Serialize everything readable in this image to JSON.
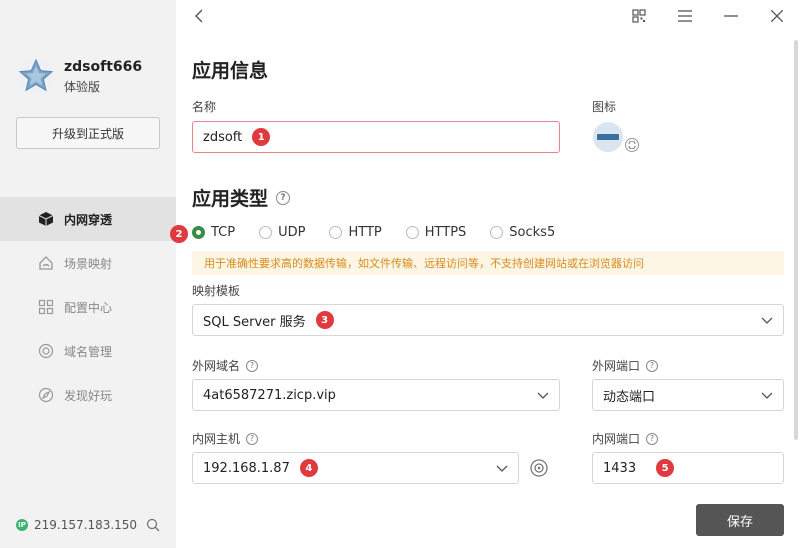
{
  "sidebar": {
    "user_name": "zdsoft666",
    "plan": "体验版",
    "upgrade_label": "升级到正式版",
    "items": [
      {
        "label": "内网穿透",
        "icon": "cube-icon",
        "active": true
      },
      {
        "label": "场景映射",
        "icon": "home-icon",
        "active": false
      },
      {
        "label": "配置中心",
        "icon": "grid-icon",
        "active": false
      },
      {
        "label": "域名管理",
        "icon": "globe-icon",
        "active": false
      },
      {
        "label": "发现好玩",
        "icon": "compass-icon",
        "active": false
      }
    ],
    "ip": "219.157.183.150",
    "ip_badge": "IP"
  },
  "app_info": {
    "title": "应用信息",
    "name_label": "名称",
    "name_value": "zdsoft",
    "name_badge": "1",
    "icon_label": "图标"
  },
  "app_type": {
    "title": "应用类型",
    "help": "?",
    "badge": "2",
    "options": [
      "TCP",
      "UDP",
      "HTTP",
      "HTTPS",
      "Socks5"
    ],
    "selected": "TCP",
    "notice": "用于准确性要求高的数据传输，如文件传输、远程访问等，不支持创建网站或在浏览器访问"
  },
  "mapping": {
    "label": "映射模板",
    "value": "SQL Server 服务",
    "badge": "3"
  },
  "external_domain": {
    "label": "外网域名",
    "value": "4at6587271.zicp.vip"
  },
  "external_port": {
    "label": "外网端口",
    "value": "动态端口"
  },
  "internal_host": {
    "label": "内网主机",
    "value": "192.168.1.87",
    "badge": "4"
  },
  "internal_port": {
    "label": "内网端口",
    "value": "1433",
    "badge": "5"
  },
  "save_label": "保存",
  "colors": {
    "accent": "#3a8a4a",
    "badge": "#e0393e",
    "notice_bg": "#fdf6e4",
    "notice_text": "#d98a1e",
    "save_bg": "#555555"
  }
}
